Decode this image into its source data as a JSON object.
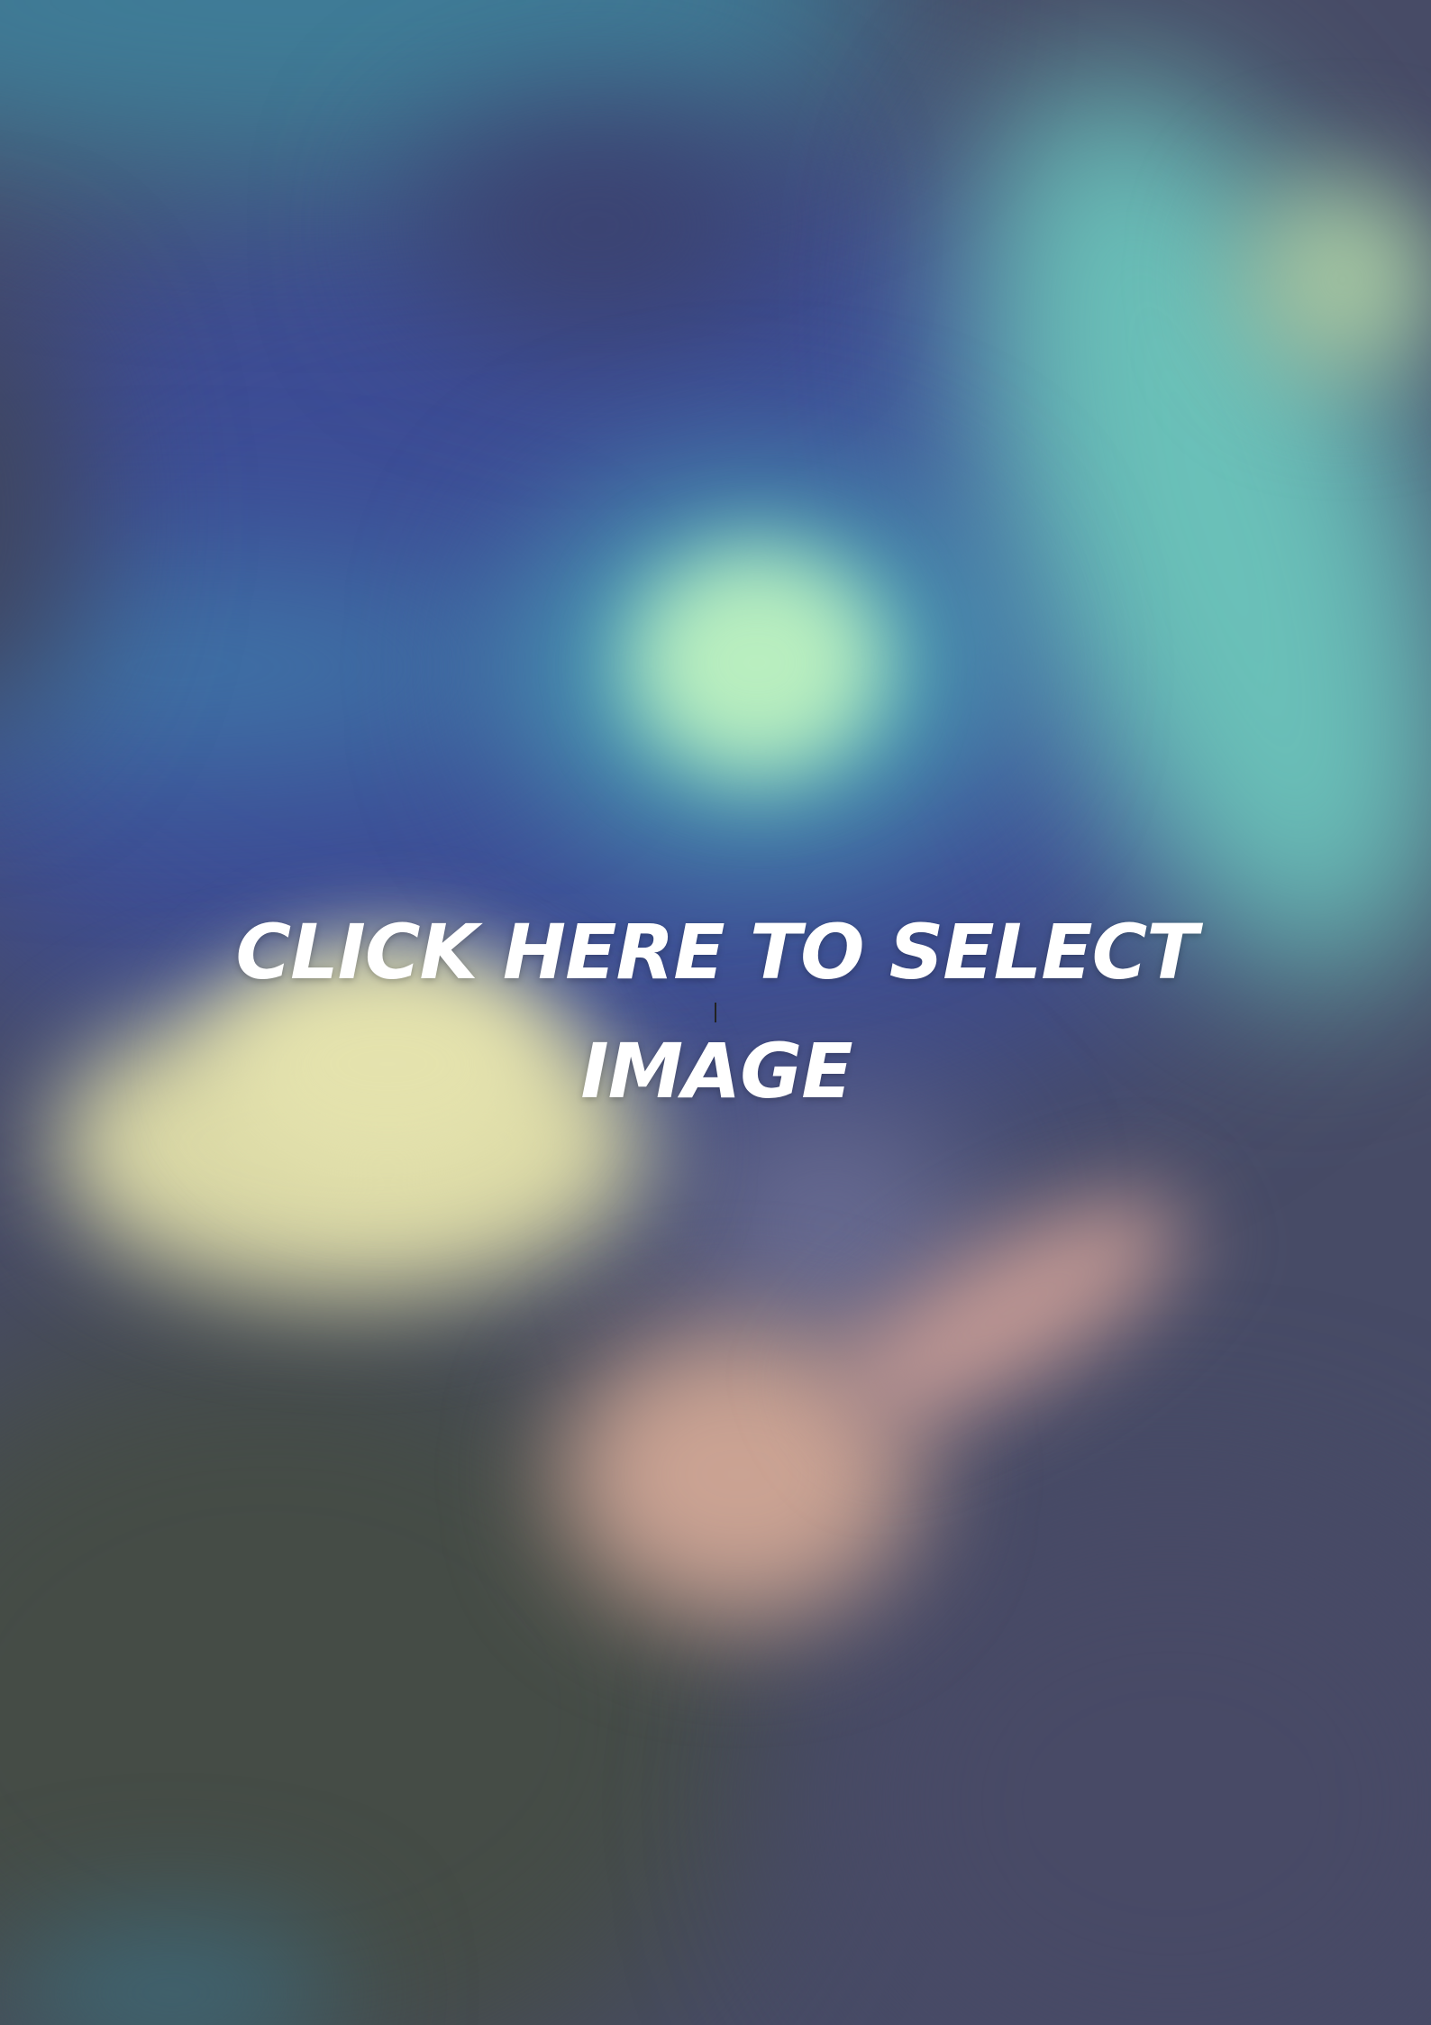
{
  "image_selector": {
    "cta_label": "CLICK HERE TO SELECT IMAGE",
    "text_color": "#ffffff",
    "background_colors": {
      "blue": "#3d4d96",
      "teal": "#6ac0b8",
      "glow": "#b9eebf",
      "hand_yellow": "#dbd9a6",
      "hand_pink": "#cba393",
      "dark": "#454c46"
    }
  }
}
